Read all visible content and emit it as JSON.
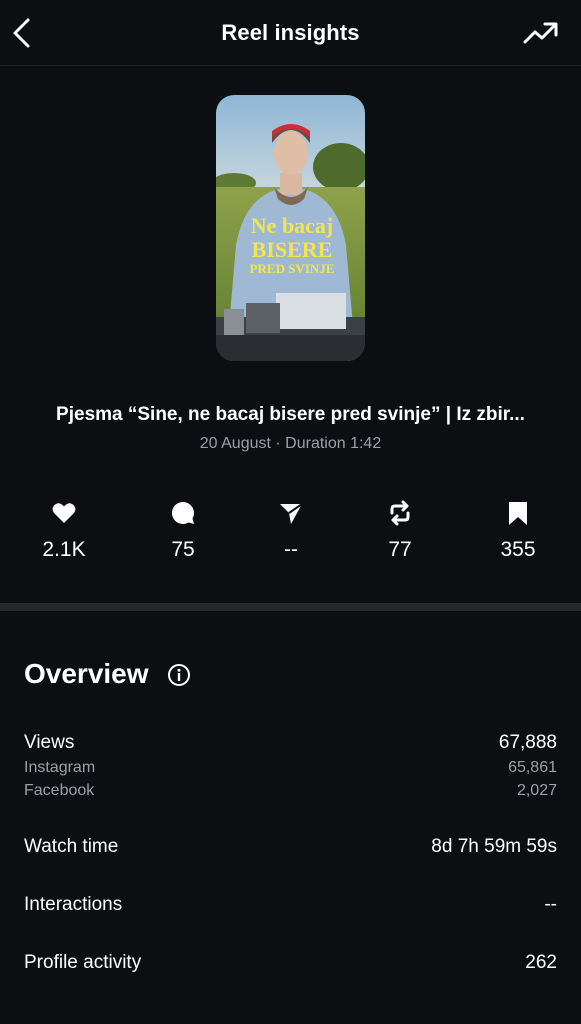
{
  "header": {
    "title": "Reel insights"
  },
  "reel": {
    "thumbnail_text": [
      "Ne bacaj",
      "BISERE",
      "PRED SVINJE"
    ],
    "title": "Pjesma “Sine, ne bacaj bisere pred svinje” | Iz zbir...",
    "meta": "20 August · Duration 1:42"
  },
  "stats": [
    {
      "icon": "heart-icon",
      "value": "2.1K"
    },
    {
      "icon": "comment-icon",
      "value": "75"
    },
    {
      "icon": "share-icon",
      "value": "--"
    },
    {
      "icon": "repost-icon",
      "value": "77"
    },
    {
      "icon": "bookmark-icon",
      "value": "355"
    }
  ],
  "overview": {
    "title": "Overview",
    "views": {
      "label": "Views",
      "value": "67,888"
    },
    "instagram": {
      "label": "Instagram",
      "value": "65,861"
    },
    "facebook": {
      "label": "Facebook",
      "value": "2,027"
    },
    "watch_time": {
      "label": "Watch time",
      "value": "8d 7h 59m 59s"
    },
    "interactions": {
      "label": "Interactions",
      "value": "--"
    },
    "profile_activity": {
      "label": "Profile activity",
      "value": "262"
    }
  },
  "colors": {
    "background": "#0c0e12",
    "secondary_text": "#9aa0a8",
    "divider": "#25282d",
    "thumbnail_text": "#f3e64a"
  }
}
